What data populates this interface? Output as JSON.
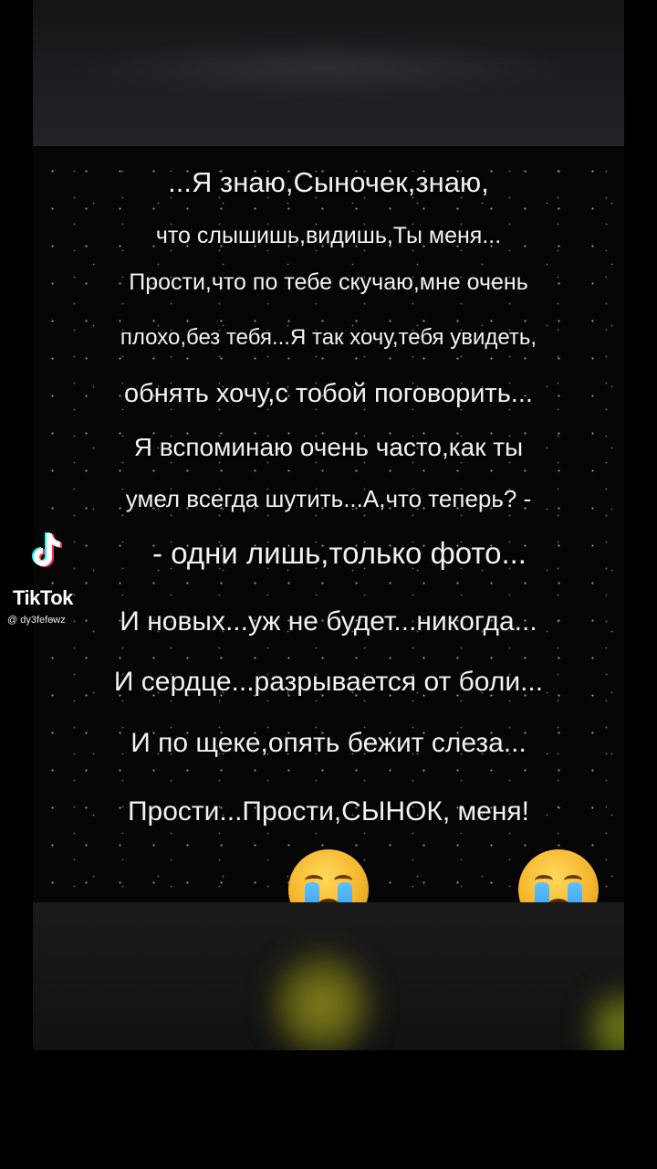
{
  "poem": {
    "lines": [
      "...Я знаю,Сыночек,знаю,",
      "что слышишь,видишь,Ты меня...",
      "Прости,что по тебе скучаю,мне очень",
      "плохо,без тебя...Я так хочу,тебя увидеть,",
      "обнять хочу,с тобой поговорить...",
      "Я вспоминаю очень часто,как ты",
      "умел всегда шутить...А,что теперь? -",
      "- одни лишь,только фото...",
      "И новых...уж не будет...никогда...",
      "И сердце...разрывается от боли...",
      "И по щеке,опять бежит слеза...",
      "Прости...Прости,СЫНОК, меня!"
    ]
  },
  "emojis": [
    "loudly-crying-face-icon",
    "loudly-crying-face-icon"
  ],
  "watermark": {
    "brand": "TikTok",
    "handle": "@ dy3fefewz"
  },
  "colors": {
    "text": "#f2f2f2",
    "background": "#000000",
    "tiktok_cyan": "#25f4ee",
    "tiktok_red": "#fe2c55"
  }
}
